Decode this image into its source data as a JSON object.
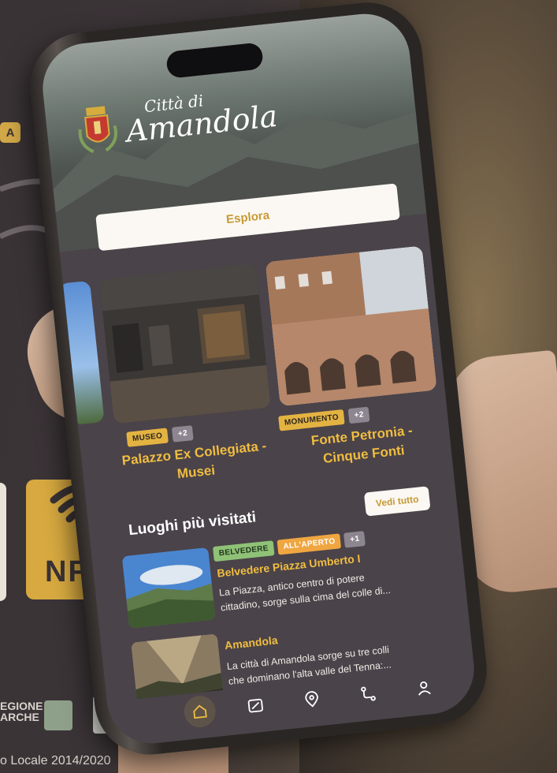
{
  "background": {
    "badge_letter": "A",
    "nfc_label": "NFC",
    "regione_line1": "EGIONE",
    "regione_line2": "ARCHE",
    "footer_text": "o Locale 2014/2020"
  },
  "app": {
    "logo_line1": "Città di",
    "logo_line2": "Amandola",
    "explore_button": "Esplora",
    "featured": [
      {
        "tag": "MUSEO",
        "extra": "+2",
        "title": "Palazzo Ex Collegiata - Musei"
      },
      {
        "tag": "MONUMENTO",
        "extra": "+2",
        "title": "Fonte Petronia - Cinque Fonti"
      }
    ],
    "section_title": "Luoghi più visitati",
    "see_all_button": "Vedi tutto",
    "list": [
      {
        "tags": [
          "BELVEDERE",
          "ALL'APERTO",
          "+1"
        ],
        "title": "Belvedere Piazza Umberto I",
        "desc_line1": "La Piazza, antico centro di potere",
        "desc_line2": "cittadino, sorge sulla cima del colle di..."
      },
      {
        "tags": [],
        "title": "Amandola",
        "desc_line1": "La città di Amandola sorge su tre colli",
        "desc_line2": "che dominano l'alta valle del Tenna:..."
      }
    ],
    "tabs": [
      "home-icon",
      "map-icon",
      "location-pin-icon",
      "route-icon",
      "profile-icon"
    ],
    "colors": {
      "accent": "#f0bd41",
      "background": "#4a4349",
      "button": "#fbf8f3"
    }
  }
}
